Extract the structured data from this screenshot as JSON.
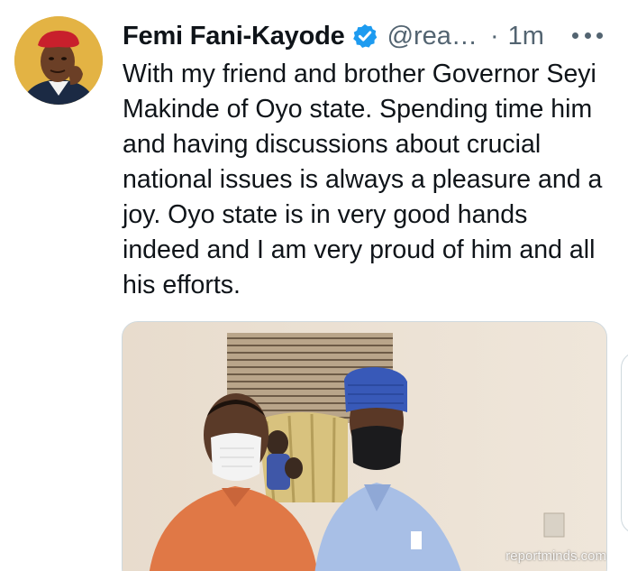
{
  "tweet": {
    "author": {
      "display_name": "Femi Fani-Kayode",
      "handle": "@rea…",
      "verified": true,
      "avatar_icon": "profile-photo"
    },
    "separator": "·",
    "timestamp": "1m",
    "more_icon": "more-horizontal-icon",
    "text": "With my friend and brother Governor Seyi Makinde of Oyo state. Spending time him and having discussions about crucial national issues is always a pleasure and a joy. Oyo state is in very good hands indeed and I am very proud of him and all his efforts.",
    "media": {
      "watermark": "reportminds.com"
    }
  },
  "colors": {
    "text_primary": "#0f1419",
    "text_secondary": "#536471",
    "verified_blue": "#1d9bf0",
    "border": "#cfd9de"
  }
}
